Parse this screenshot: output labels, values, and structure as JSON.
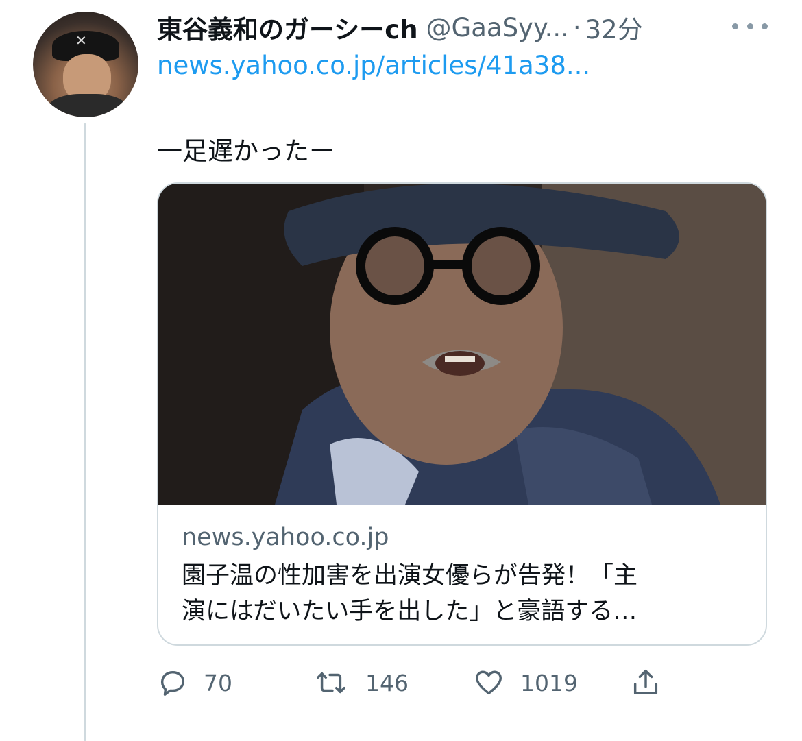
{
  "tweet": {
    "display_name": "東谷義和のガーシーch",
    "handle": "@GaaSyy...",
    "separator": "·",
    "time": "32分",
    "link": "news.yahoo.co.jp/articles/41a38...",
    "text": "一足遅かったー",
    "avatar_icon": "user-avatar"
  },
  "card": {
    "domain": "news.yahoo.co.jp",
    "title_line1": "園子温の性加害を出演女優らが告発！「主",
    "title_line2": "演にはだいたい手を出した」と豪語する…",
    "image_icon": "article-photo"
  },
  "actions": {
    "reply": {
      "icon": "reply-icon",
      "count": "70"
    },
    "retweet": {
      "icon": "retweet-icon",
      "count": "146"
    },
    "like": {
      "icon": "heart-icon",
      "count": "1019"
    },
    "share": {
      "icon": "share-icon"
    }
  },
  "colors": {
    "link": "#1d9bf0",
    "secondary_text": "#536471",
    "border": "#cfd9de",
    "primary_text": "#0f1419"
  }
}
